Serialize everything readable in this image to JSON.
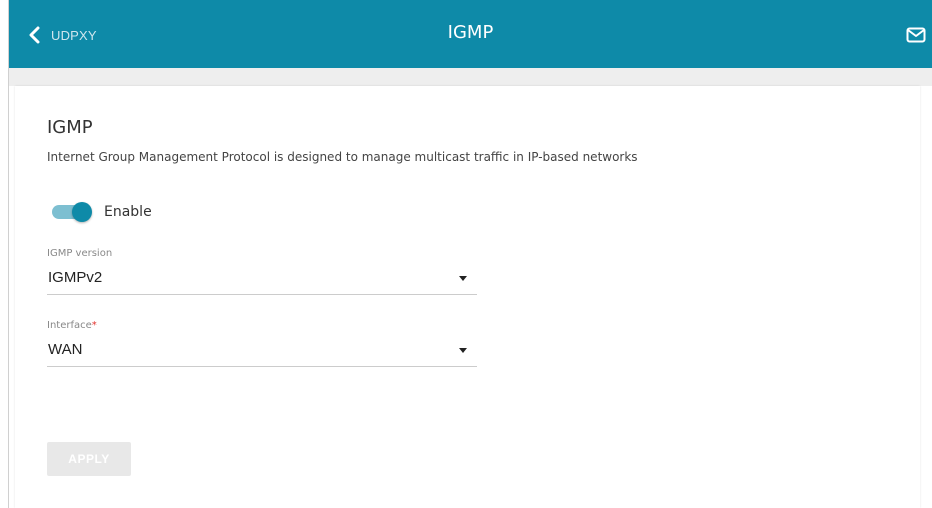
{
  "header": {
    "back_label": "UDPXY",
    "title": "IGMP",
    "back_icon": "chevron-left-icon",
    "mail_icon": "envelope-icon",
    "background_color": "#0e8aa8"
  },
  "section": {
    "title": "IGMP",
    "description": "Internet Group Management Protocol is designed to manage multicast traffic in IP-based networks"
  },
  "enable_toggle": {
    "label": "Enable",
    "on": true,
    "accent_color": "#0e8aa8"
  },
  "igmp_version": {
    "label": "IGMP version",
    "value": "IGMPv2"
  },
  "interface": {
    "label": "Interface",
    "required_mark": "*",
    "value": "WAN"
  },
  "apply_button": {
    "label": "APPLY",
    "disabled": true
  }
}
